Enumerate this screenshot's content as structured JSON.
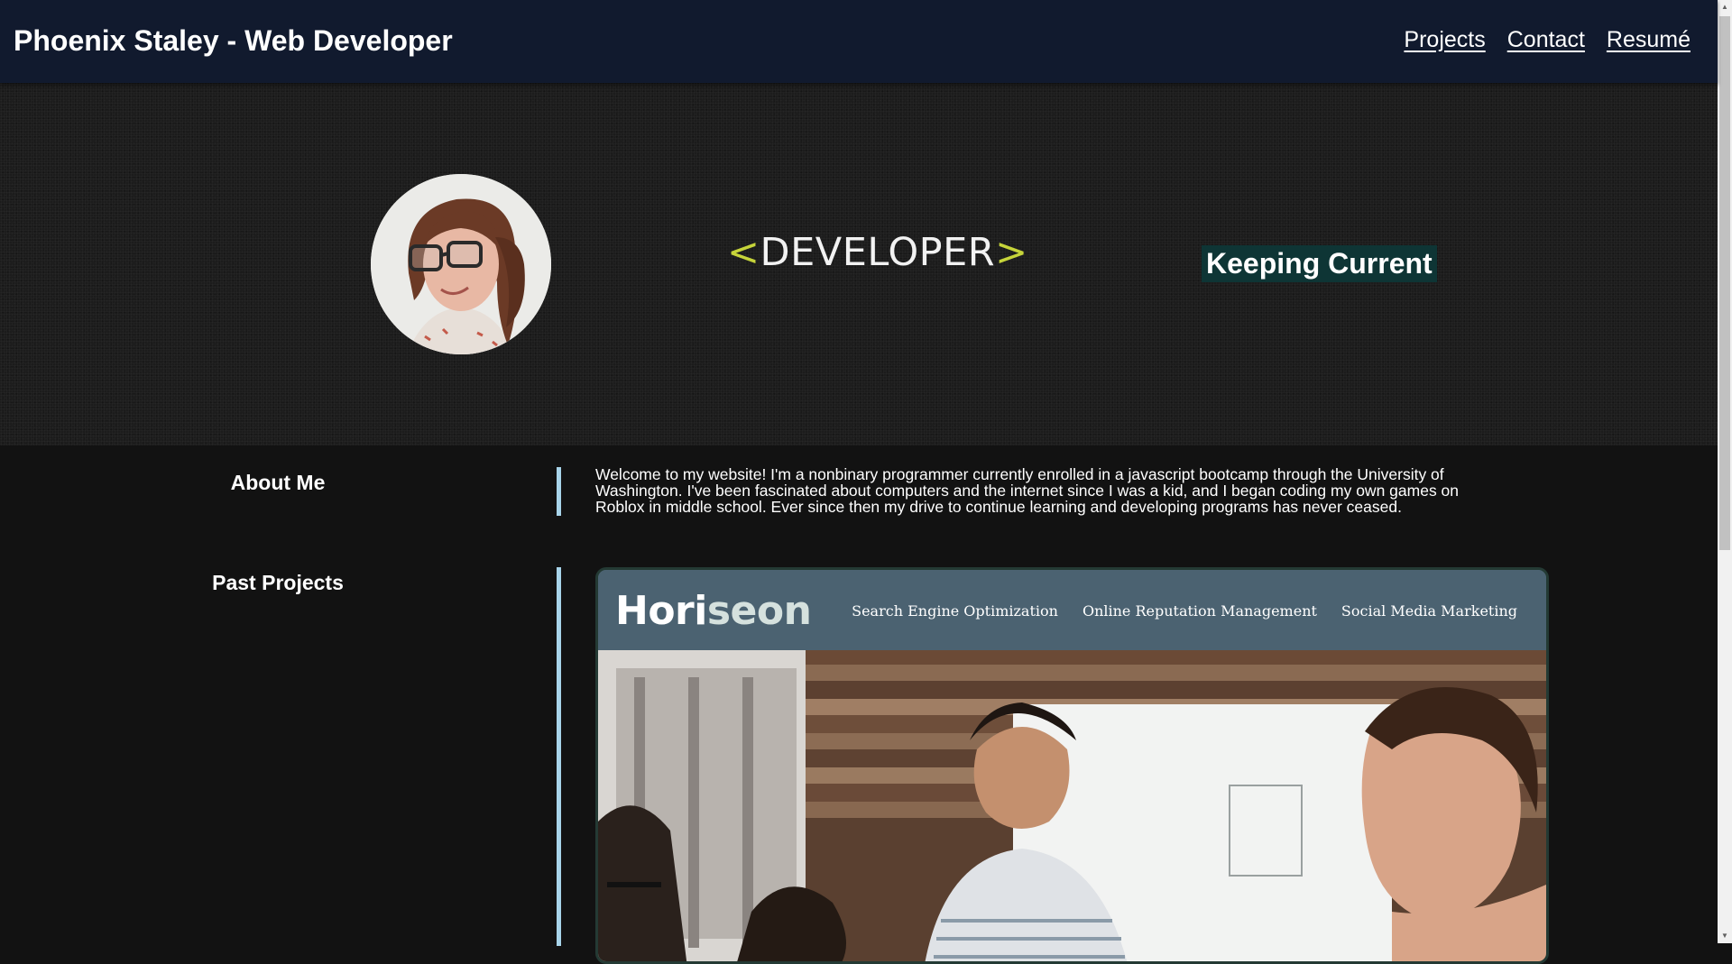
{
  "header": {
    "title": "Phoenix Staley - Web Developer",
    "nav": [
      "Projects",
      "Contact",
      "Resumé"
    ]
  },
  "hero": {
    "developer_logo": {
      "open": "<",
      "word": "DEVELOPER",
      "close": ">"
    },
    "keeping_current": "Keeping Current"
  },
  "about": {
    "heading": "About Me",
    "text": "Welcome to my website! I'm a nonbinary programmer currently enrolled in a javascript bootcamp through the University of Washington. I've been fascinated about computers and the internet since I was a kid, and I began coding my own games on Roblox in middle school. Ever since then my drive to continue learning and developing programs has never ceased."
  },
  "projects": {
    "heading": "Past Projects",
    "items": [
      {
        "logo_main": "Hori",
        "logo_accent": "seon",
        "nav": [
          "Search Engine Optimization",
          "Online Reputation Management",
          "Social Media Marketing"
        ]
      }
    ]
  },
  "colors": {
    "topbar": "#111a2e",
    "accent_line": "#a8d4ea",
    "keeping_current_bg": "#0e3535",
    "logo_bracket": "#c6d43a",
    "horiseon_header": "#4b6271"
  },
  "icons": {
    "scroll_up": "▲",
    "scroll_down": "▼"
  }
}
